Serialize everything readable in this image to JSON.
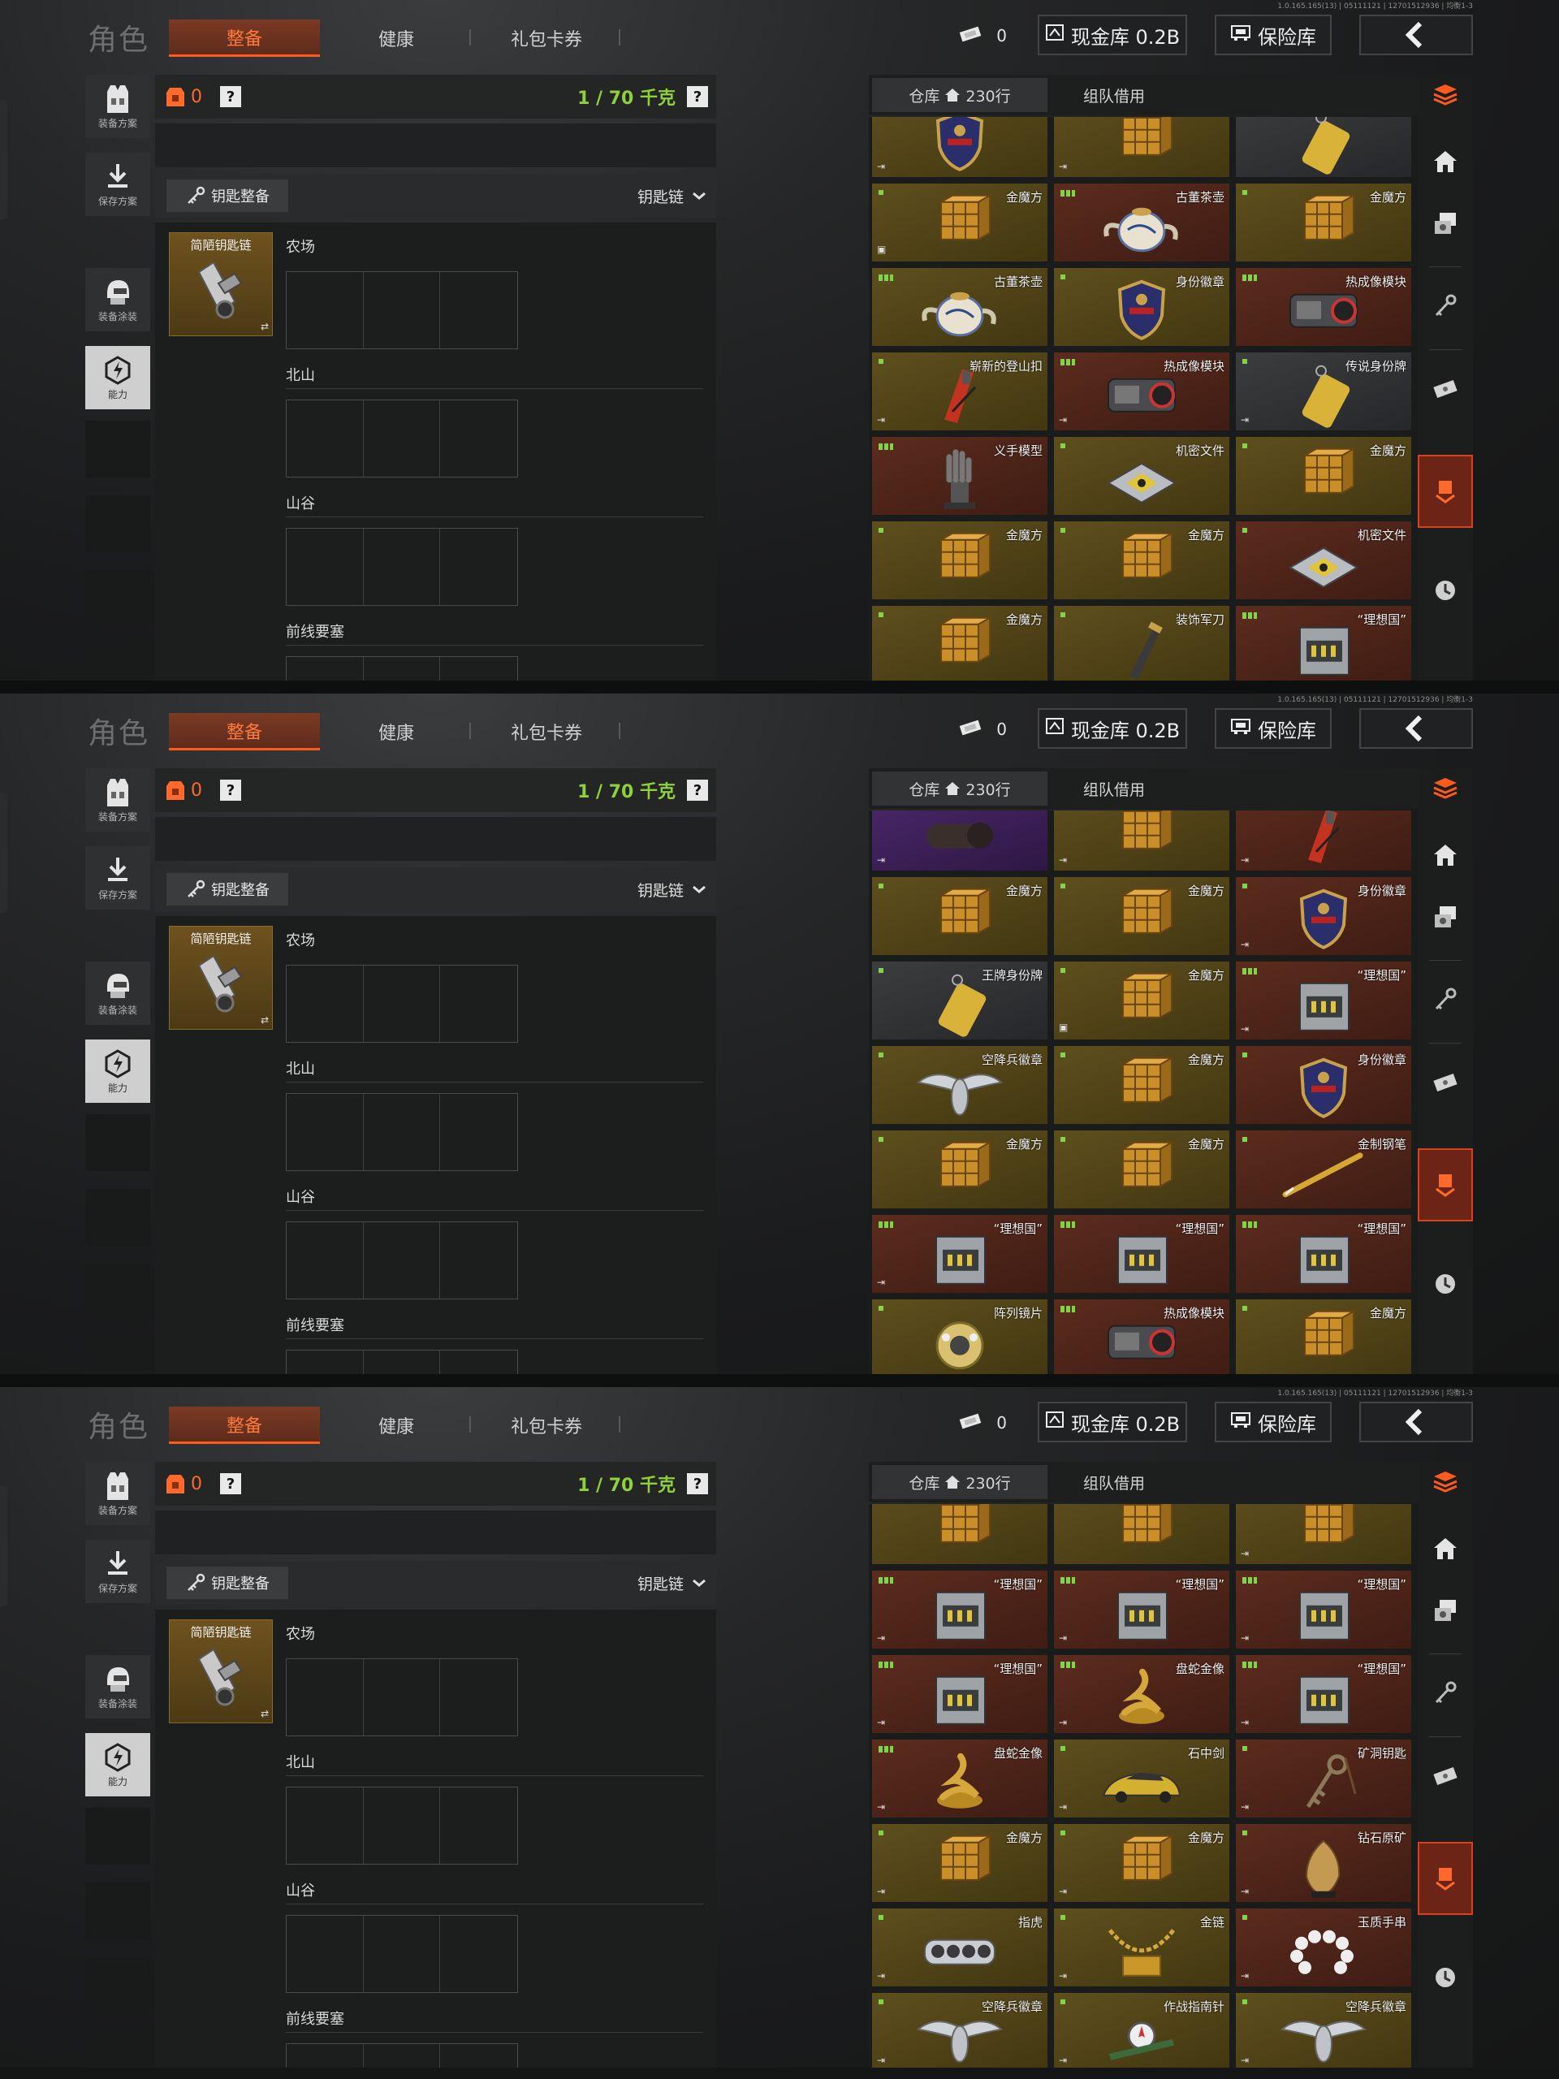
{
  "version": "1.0.165.165(13) | 05111121 | 12701512936 | 均衡1-3",
  "nav": {
    "title": "角色",
    "tabs": [
      "整备",
      "健康",
      "礼包卡券"
    ],
    "ticket_count": "0",
    "cash_label": "现金库 0.2B",
    "safe_label": "保险库"
  },
  "left_buttons": [
    "装备方案",
    "保存方案",
    "装备涂装",
    "能力"
  ],
  "weight": {
    "armor_count": "0",
    "question": "?",
    "value": "1 / 70 千克"
  },
  "keychain": {
    "button_label": "钥匙整备",
    "select_label": "钥匙链",
    "slot_name": "简陋钥匙链",
    "locations": [
      "农场",
      "北山",
      "山谷",
      "前线要塞"
    ]
  },
  "warehouse": {
    "tab_label": "仓库",
    "rows": "230行",
    "other_tab": "组队借用"
  },
  "colors": {
    "accent": "#ff5a1e",
    "weight_green": "#8ed13b",
    "gold": "#5e4f1d",
    "brown": "#5c2c1e"
  },
  "panels": [
    {
      "cells": [
        {
          "bg": "gold",
          "icon": "badge",
          "name": "",
          "mark": "",
          "exit": true
        },
        {
          "bg": "gold",
          "icon": "cube",
          "name": "",
          "mark": "",
          "exit": true
        },
        {
          "bg": "gray",
          "icon": "tag",
          "name": "",
          "mark": "",
          "exit": false
        },
        {
          "bg": "gold",
          "icon": "cube",
          "name": "金魔方",
          "mark": "dot",
          "exit": false,
          "extra": "▣"
        },
        {
          "bg": "brown",
          "icon": "teapot",
          "name": "古董茶壶",
          "mark": "dot4",
          "exit": false
        },
        {
          "bg": "gold",
          "icon": "cube",
          "name": "金魔方",
          "mark": "dot",
          "exit": false
        },
        {
          "bg": "gold",
          "icon": "teapot",
          "name": "古董茶壶",
          "mark": "dot4",
          "exit": false
        },
        {
          "bg": "gold",
          "icon": "badge",
          "name": "身份徽章",
          "mark": "dot",
          "exit": false
        },
        {
          "bg": "brown",
          "icon": "device",
          "name": "热成像模块",
          "mark": "dot4",
          "exit": false
        },
        {
          "bg": "gold",
          "icon": "clip",
          "name": "崭新的登山扣",
          "mark": "dot",
          "exit": true
        },
        {
          "bg": "brown",
          "icon": "device",
          "name": "热成像模块",
          "mark": "dot4",
          "exit": true
        },
        {
          "bg": "gray",
          "icon": "tag",
          "name": "传说身份牌",
          "mark": "dot",
          "exit": true
        },
        {
          "bg": "brown",
          "icon": "hand",
          "name": "义手模型",
          "mark": "dot4",
          "exit": false
        },
        {
          "bg": "gold",
          "icon": "file",
          "name": "机密文件",
          "mark": "dot",
          "exit": false
        },
        {
          "bg": "gold",
          "icon": "cube",
          "name": "金魔方",
          "mark": "dot",
          "exit": false
        },
        {
          "bg": "gold",
          "icon": "cube",
          "name": "金魔方",
          "mark": "dot",
          "exit": false
        },
        {
          "bg": "gold",
          "icon": "cube",
          "name": "金魔方",
          "mark": "dot",
          "exit": false
        },
        {
          "bg": "brown",
          "icon": "file",
          "name": "机密文件",
          "mark": "dot",
          "exit": false
        },
        {
          "bg": "gold",
          "icon": "cube",
          "name": "金魔方",
          "mark": "dot",
          "exit": false
        },
        {
          "bg": "gold",
          "icon": "knife",
          "name": "装饰军刀",
          "mark": "dot",
          "exit": false
        },
        {
          "bg": "brown",
          "icon": "case",
          "name": "“理想国”",
          "mark": "dot4",
          "exit": false
        }
      ]
    },
    {
      "cells": [
        {
          "bg": "purple",
          "icon": "pipe",
          "name": "",
          "mark": "",
          "exit": true
        },
        {
          "bg": "gold",
          "icon": "cube",
          "name": "",
          "mark": "",
          "exit": true
        },
        {
          "bg": "brown",
          "icon": "clip",
          "name": "",
          "mark": "",
          "exit": true
        },
        {
          "bg": "gold",
          "icon": "cube",
          "name": "金魔方",
          "mark": "dot",
          "exit": false
        },
        {
          "bg": "gold",
          "icon": "cube",
          "name": "金魔方",
          "mark": "dot",
          "exit": false
        },
        {
          "bg": "brown",
          "icon": "badge",
          "name": "身份徽章",
          "mark": "dot",
          "exit": true
        },
        {
          "bg": "gray",
          "icon": "tag",
          "name": "王牌身份牌",
          "mark": "dot",
          "exit": false
        },
        {
          "bg": "gold",
          "icon": "cube",
          "name": "金魔方",
          "mark": "dot",
          "exit": false,
          "extra": "▣"
        },
        {
          "bg": "brown",
          "icon": "case",
          "name": "“理想国”",
          "mark": "dot4",
          "exit": true
        },
        {
          "bg": "gold",
          "icon": "wings",
          "name": "空降兵徽章",
          "mark": "dot",
          "exit": false
        },
        {
          "bg": "gold",
          "icon": "cube",
          "name": "金魔方",
          "mark": "dot",
          "exit": false
        },
        {
          "bg": "brown",
          "icon": "badge",
          "name": "身份徽章",
          "mark": "dot",
          "exit": false
        },
        {
          "bg": "gold",
          "icon": "cube",
          "name": "金魔方",
          "mark": "dot",
          "exit": false
        },
        {
          "bg": "gold",
          "icon": "cube",
          "name": "金魔方",
          "mark": "dot",
          "exit": false
        },
        {
          "bg": "brown",
          "icon": "pen",
          "name": "金制钢笔",
          "mark": "dot",
          "exit": false
        },
        {
          "bg": "brown",
          "icon": "case",
          "name": "“理想国”",
          "mark": "dot4",
          "exit": true
        },
        {
          "bg": "brown",
          "icon": "case",
          "name": "“理想国”",
          "mark": "dot4",
          "exit": false
        },
        {
          "bg": "brown",
          "icon": "case",
          "name": "“理想国”",
          "mark": "dot4",
          "exit": false
        },
        {
          "bg": "gold",
          "icon": "lens",
          "name": "阵列镜片",
          "mark": "dot",
          "exit": false
        },
        {
          "bg": "brown",
          "icon": "device",
          "name": "热成像模块",
          "mark": "dot4",
          "exit": false
        },
        {
          "bg": "gold",
          "icon": "cube",
          "name": "金魔方",
          "mark": "dot",
          "exit": false
        }
      ]
    },
    {
      "cells": [
        {
          "bg": "gold",
          "icon": "cube",
          "name": "",
          "mark": "",
          "exit": false
        },
        {
          "bg": "gold",
          "icon": "cube",
          "name": "",
          "mark": "",
          "exit": false
        },
        {
          "bg": "gold",
          "icon": "cube",
          "name": "",
          "mark": "",
          "exit": true
        },
        {
          "bg": "brown",
          "icon": "case",
          "name": "“理想国”",
          "mark": "dot4",
          "exit": true
        },
        {
          "bg": "brown",
          "icon": "case",
          "name": "“理想国”",
          "mark": "dot4",
          "exit": true
        },
        {
          "bg": "brown",
          "icon": "case",
          "name": "“理想国”",
          "mark": "dot4",
          "exit": true
        },
        {
          "bg": "brown",
          "icon": "case",
          "name": "“理想国”",
          "mark": "dot4",
          "exit": true
        },
        {
          "bg": "brown",
          "icon": "snake",
          "name": "盘蛇金像",
          "mark": "dot4",
          "exit": true
        },
        {
          "bg": "brown",
          "icon": "case",
          "name": "“理想国”",
          "mark": "dot4",
          "exit": true
        },
        {
          "bg": "brown",
          "icon": "snake",
          "name": "盘蛇金像",
          "mark": "dot4",
          "exit": true
        },
        {
          "bg": "gold",
          "icon": "car",
          "name": "石中剑",
          "mark": "dot",
          "exit": true
        },
        {
          "bg": "brown",
          "icon": "key",
          "name": "矿洞钥匙",
          "mark": "dot",
          "exit": true
        },
        {
          "bg": "gold",
          "icon": "cube",
          "name": "金魔方",
          "mark": "dot",
          "exit": true
        },
        {
          "bg": "gold",
          "icon": "cube",
          "name": "金魔方",
          "mark": "dot",
          "exit": true
        },
        {
          "bg": "brown",
          "icon": "ore",
          "name": "钻石原矿",
          "mark": "dot",
          "exit": true
        },
        {
          "bg": "gold",
          "icon": "knuckle",
          "name": "指虎",
          "mark": "dot",
          "exit": true
        },
        {
          "bg": "gold",
          "icon": "chain",
          "name": "金链",
          "mark": "dot",
          "exit": true
        },
        {
          "bg": "brown",
          "icon": "beads",
          "name": "玉质手串",
          "mark": "dot",
          "exit": true
        },
        {
          "bg": "gold",
          "icon": "wings",
          "name": "空降兵徽章",
          "mark": "dot",
          "exit": true
        },
        {
          "bg": "gold",
          "icon": "compass",
          "name": "作战指南针",
          "mark": "dot",
          "exit": true
        },
        {
          "bg": "gold",
          "icon": "wings",
          "name": "空降兵徽章",
          "mark": "dot",
          "exit": true
        }
      ]
    }
  ]
}
